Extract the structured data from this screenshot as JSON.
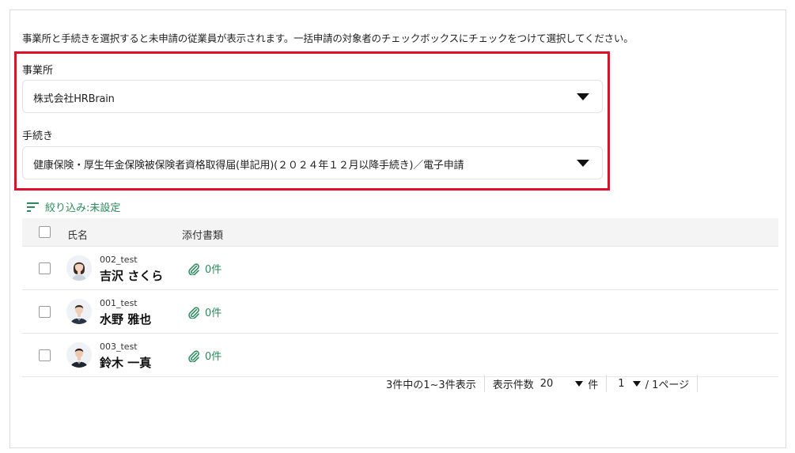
{
  "instruction": "事業所と手続きを選択すると未申請の従業員が表示されます。一括申請の対象者のチェックボックスにチェックをつけて選択してください。",
  "office": {
    "label": "事業所",
    "value": "株式会社HRBrain"
  },
  "procedure": {
    "label": "手続き",
    "value": "健康保険・厚生年金保険被保険者資格取得届(単記用)(２０２４年１２月以降手続き)／電子申請"
  },
  "filter": {
    "label": "絞り込み:未設定"
  },
  "table": {
    "headers": {
      "name": "氏名",
      "attachments": "添付書類"
    },
    "rows": [
      {
        "id": "002_test",
        "name": "吉沢 さくら",
        "attachments": "0件",
        "avatar": "woman"
      },
      {
        "id": "001_test",
        "name": "水野 雅也",
        "attachments": "0件",
        "avatar": "man"
      },
      {
        "id": "003_test",
        "name": "鈴木 一真",
        "attachments": "0件",
        "avatar": "man"
      }
    ]
  },
  "pagination": {
    "summary": "3件中の1~3件表示",
    "per_page_label": "表示件数",
    "per_page_value": "20",
    "per_page_unit": "件",
    "page_value": "1",
    "page_total": "/ 1ページ"
  },
  "colors": {
    "highlight": "#e0102a",
    "accent_green": "#2a8a5a"
  }
}
